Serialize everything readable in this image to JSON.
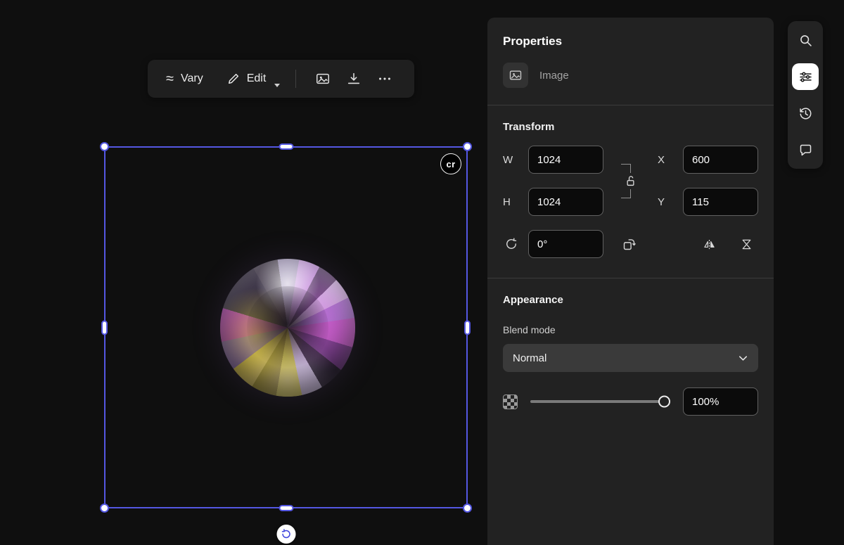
{
  "icons": {
    "vary": "≈"
  },
  "canvas_toolbar": {
    "vary_label": "Vary",
    "edit_label": "Edit"
  },
  "selection": {
    "credentials_badge": "cr"
  },
  "properties_panel": {
    "title": "Properties",
    "layer_type": "Image",
    "transform": {
      "title": "Transform",
      "width": {
        "label": "W",
        "value": "1024"
      },
      "height": {
        "label": "H",
        "value": "1024"
      },
      "x": {
        "label": "X",
        "value": "600"
      },
      "y": {
        "label": "Y",
        "value": "115"
      },
      "rotation_value": "0°"
    },
    "appearance": {
      "title": "Appearance",
      "blend_mode_label": "Blend mode",
      "blend_mode_value": "Normal",
      "opacity_value": "100%",
      "opacity_percent": 100
    }
  },
  "colors": {
    "accent": "#5457e2",
    "panel_bg": "#222222",
    "canvas_bg": "#0f0f0f",
    "active_tool_bg": "#ffffff"
  }
}
